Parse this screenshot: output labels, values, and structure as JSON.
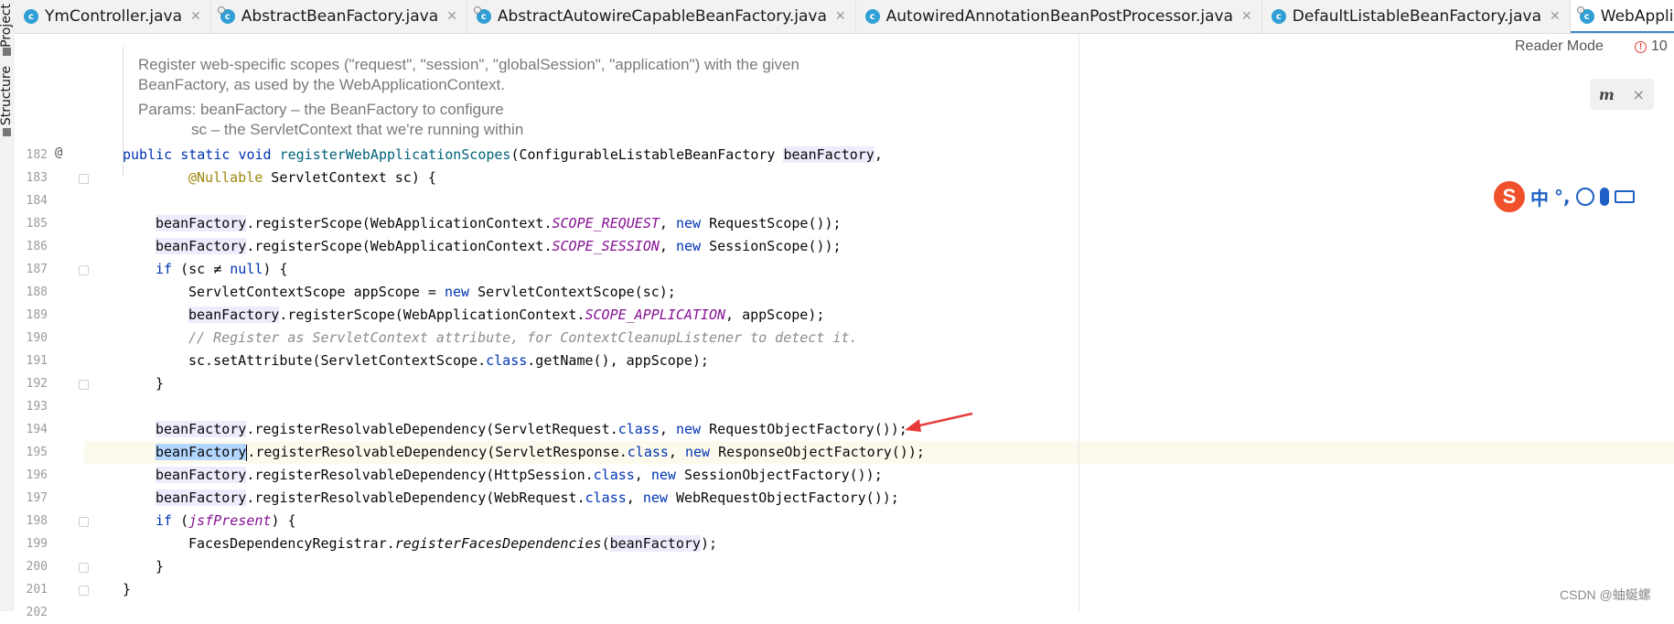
{
  "tabs": [
    {
      "label": "YmController.java",
      "active": false,
      "icon": "class-icon"
    },
    {
      "label": "AbstractBeanFactory.java",
      "active": false,
      "icon": "class-icon"
    },
    {
      "label": "AbstractAutowireCapableBeanFactory.java",
      "active": false,
      "icon": "class-icon"
    },
    {
      "label": "AutowiredAnnotationBeanPostProcessor.java",
      "active": false,
      "icon": "class-icon"
    },
    {
      "label": "DefaultListableBeanFactory.java",
      "active": false,
      "icon": "class-icon"
    },
    {
      "label": "WebApplicationContextUtils.java",
      "active": true,
      "icon": "class-icon"
    }
  ],
  "side_panels": [
    "Project",
    "Structure"
  ],
  "doc_comment": {
    "line1": "Register web-specific scopes (\"request\", \"session\", \"globalSession\", \"application\") with the given",
    "line2": "BeanFactory, as used by the WebApplicationContext.",
    "params_line1": "Params: beanFactory – the BeanFactory to configure",
    "params_line2": "sc – the ServletContext that we're running within"
  },
  "line_numbers": [
    "182",
    "183",
    "184",
    "185",
    "186",
    "187",
    "188",
    "189",
    "190",
    "191",
    "192",
    "193",
    "194",
    "195",
    "196",
    "197",
    "198",
    "199",
    "200",
    "201",
    "202"
  ],
  "gutter_marker": "@",
  "code": {
    "l182": {
      "kw1": "public",
      "kw2": "static",
      "kw3": "void",
      "fn": "registerWebApplicationScopes",
      "t1": "(ConfigurableListableBeanFactory ",
      "var": "beanFactory",
      "t2": ","
    },
    "l183": {
      "an": "@Nullable",
      "t": " ServletContext sc) {"
    },
    "l185": {
      "var": "beanFactory",
      "t1": ".registerScope(WebApplicationContext.",
      "st": "SCOPE_REQUEST",
      "t2": ", ",
      "kw": "new",
      "t3": " RequestScope());"
    },
    "l186": {
      "var": "beanFactory",
      "t1": ".registerScope(WebApplicationContext.",
      "st": "SCOPE_SESSION",
      "t2": ", ",
      "kw": "new",
      "t3": " SessionScope());"
    },
    "l187": {
      "kw": "if",
      "t1": " (sc ≠ ",
      "kw2": "null",
      "t2": ") {"
    },
    "l188": {
      "t1": "ServletContextScope appScope = ",
      "kw": "new",
      "t2": " ServletContextScope(sc);"
    },
    "l189": {
      "var": "beanFactory",
      "t1": ".registerScope(WebApplicationContext.",
      "st": "SCOPE_APPLICATION",
      "t2": ", appScope);"
    },
    "l190": {
      "cm": "// Register as ServletContext attribute, for ContextCleanupListener to detect it."
    },
    "l191": {
      "t1": "sc.setAttribute(ServletContextScope.",
      "kw": "class",
      "t2": ".getName(), appScope);"
    },
    "l192": {
      "t": "}"
    },
    "l194": {
      "var": "beanFactory",
      "t1": ".registerResolvableDependency(ServletRequest.",
      "kw": "class",
      "t2": ", ",
      "kw2": "new",
      "t3": " RequestObjectFactory());"
    },
    "l195": {
      "var": "beanFactory",
      "t1": ".registerResolvableDependency(ServletResponse.",
      "kw": "class",
      "t2": ", ",
      "kw2": "new",
      "t3": " ResponseObjectFactory());"
    },
    "l196": {
      "var": "beanFactory",
      "t1": ".registerResolvableDependency(HttpSession.",
      "kw": "class",
      "t2": ", ",
      "kw2": "new",
      "t3": " SessionObjectFactory());"
    },
    "l197": {
      "var": "beanFactory",
      "t1": ".registerResolvableDependency(WebRequest.",
      "kw": "class",
      "t2": ", ",
      "kw2": "new",
      "t3": " WebRequestObjectFactory());"
    },
    "l198": {
      "kw": "if",
      "t1": " (",
      "it": "jsfPresent",
      "t2": ") {"
    },
    "l199": {
      "t1": "FacesDependencyRegistrar.",
      "it": "registerFacesDependencies",
      "t2": "(",
      "var": "beanFactory",
      "t3": ");"
    },
    "l200": {
      "t": "}"
    },
    "l201": {
      "t": "}"
    }
  },
  "reader_mode": "Reader Mode",
  "problems_count": "10",
  "ime": {
    "logo": "S",
    "lang": "中",
    "punct": "°,"
  },
  "m_panel": {
    "logo": "m",
    "close": "×"
  },
  "watermark": "CSDN @蚰蜒螺",
  "colors": {
    "keyword": "#0033b3",
    "method": "#00627a",
    "static_field": "#871094",
    "annotation": "#9e880d",
    "comment": "#8c8c8c",
    "accent": "#4083c9",
    "arrow": "#e83a3a"
  }
}
